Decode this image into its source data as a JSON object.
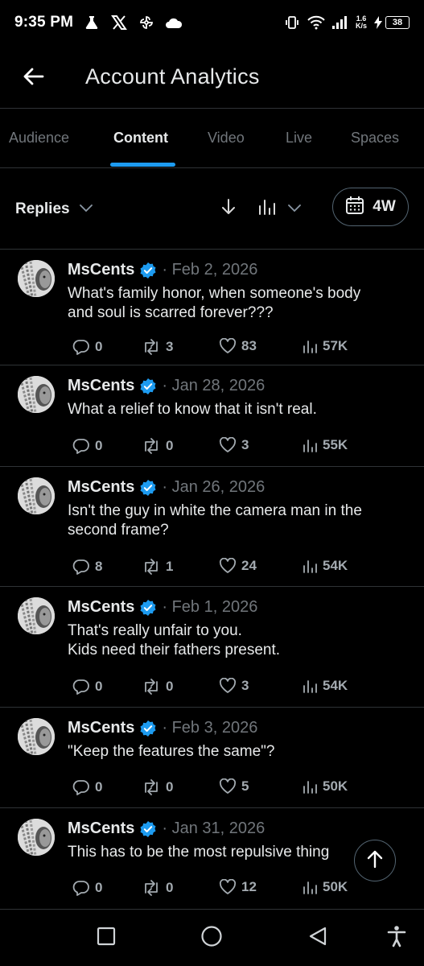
{
  "status_bar": {
    "time": "9:35 PM",
    "net_speed_value": "1.6",
    "net_speed_unit": "K/s",
    "battery": "38",
    "icons": [
      "flask-icon",
      "x-logo-icon",
      "pinwheel-icon",
      "cloud-icon",
      "vibrate-icon",
      "wifi-icon",
      "signal-icon",
      "charging-bolt-icon"
    ]
  },
  "header": {
    "title": "Account Analytics",
    "back_icon": "arrow-left-icon"
  },
  "tabs": [
    {
      "label": "Audience",
      "active": false
    },
    {
      "label": "Content",
      "active": true
    },
    {
      "label": "Video",
      "active": false
    },
    {
      "label": "Live",
      "active": false
    },
    {
      "label": "Spaces",
      "active": false
    }
  ],
  "filters": {
    "type_label": "Replies",
    "range_label": "4W"
  },
  "colors": {
    "accent": "#1d9bf0",
    "background": "#000000",
    "divider": "#2f3336",
    "muted_text": "#71767b"
  },
  "posts": [
    {
      "author": "MsCents",
      "date": "· Feb 2, 2026",
      "text": "What's family honor, when someone's body\nand soul is scarred forever???",
      "replies": "0",
      "reposts": "3",
      "likes": "83",
      "views": "57K"
    },
    {
      "author": "MsCents",
      "date": "· Jan 28, 2026",
      "text": "What a relief to know that it isn't real.",
      "replies": "0",
      "reposts": "0",
      "likes": "3",
      "views": "55K"
    },
    {
      "author": "MsCents",
      "date": "· Jan 26, 2026",
      "text": "Isn't the guy in white the camera man in the\nsecond frame?",
      "replies": "8",
      "reposts": "1",
      "likes": "24",
      "views": "54K"
    },
    {
      "author": "MsCents",
      "date": "· Feb 1, 2026",
      "text": "That's really unfair to you.\nKids need their fathers present.",
      "replies": "0",
      "reposts": "0",
      "likes": "3",
      "views": "54K"
    },
    {
      "author": "MsCents",
      "date": "· Feb 3, 2026",
      "text": "\"Keep the features the same\"?",
      "replies": "0",
      "reposts": "0",
      "likes": "5",
      "views": "50K"
    },
    {
      "author": "MsCents",
      "date": "· Jan 31, 2026",
      "text": "This has to be the most repulsive thing",
      "replies": "0",
      "reposts": "0",
      "likes": "12",
      "views": "50K"
    }
  ]
}
